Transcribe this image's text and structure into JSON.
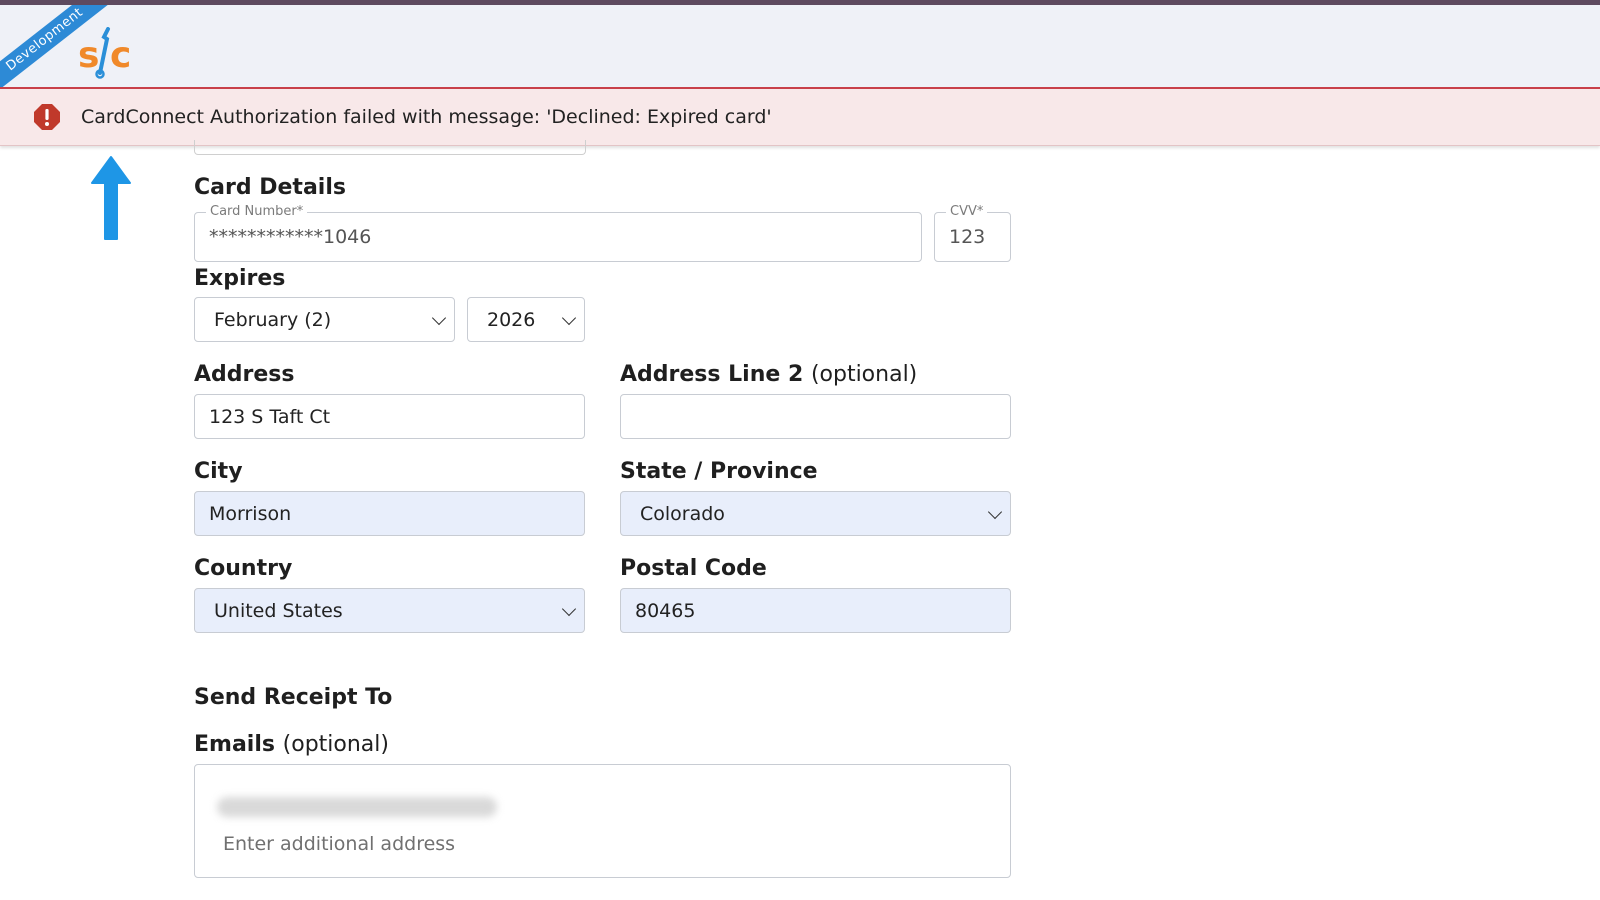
{
  "env_badge": "Development",
  "alert": {
    "message": "CardConnect Authorization failed with message: 'Declined: Expired card'",
    "icon": "alert-exclamation-icon",
    "color": "#c0392b"
  },
  "card": {
    "section_title": "Card Details",
    "number_label": "Card Number*",
    "number_value": "************1046",
    "cvv_label": "CVV*",
    "cvv_value": "123"
  },
  "expires": {
    "label": "Expires",
    "month": "February (2)",
    "year": "2026"
  },
  "address": {
    "address_label": "Address",
    "address_value": "123 S Taft Ct",
    "line2_label": "Address Line 2",
    "line2_optional": "(optional)",
    "line2_value": "",
    "city_label": "City",
    "city_value": "Morrison",
    "state_label": "State / Province",
    "state_value": "Colorado",
    "country_label": "Country",
    "country_value": "United States",
    "postal_label": "Postal Code",
    "postal_value": "80465"
  },
  "receipt": {
    "section_title": "Send Receipt To",
    "emails_label": "Emails",
    "emails_optional": "(optional)",
    "placeholder": "Enter additional address"
  },
  "colors": {
    "accent_blue": "#1e96e6",
    "logo_orange": "#f0892a",
    "autofill_bg": "#e8eefb",
    "alert_bg": "#f8e8e9"
  }
}
